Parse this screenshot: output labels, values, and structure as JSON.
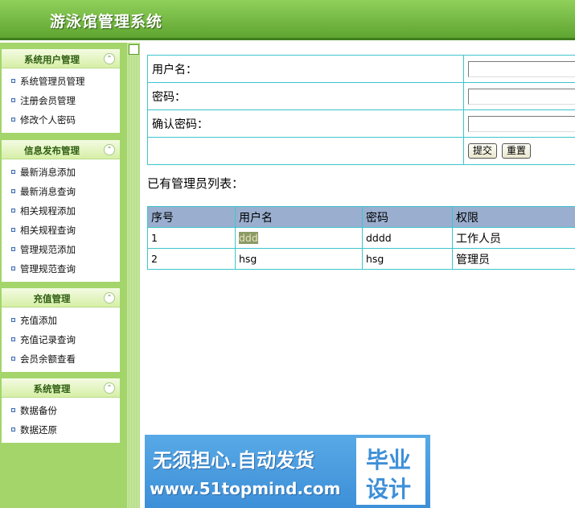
{
  "app": {
    "title": "游泳馆管理系统"
  },
  "sidebar": {
    "groups": [
      {
        "title": "系统用户管理",
        "toggle": "⌃",
        "items": [
          "系统管理员管理",
          "注册会员管理",
          "修改个人密码"
        ]
      },
      {
        "title": "信息发布管理",
        "toggle": "⌃",
        "items": [
          "最新消息添加",
          "最新消息查询",
          "相关规程添加",
          "相关规程查询",
          "管理规范添加",
          "管理规范查询"
        ]
      },
      {
        "title": "充值管理",
        "toggle": "⌃",
        "items": [
          "充值添加",
          "充值记录查询",
          "会员余额查看"
        ]
      },
      {
        "title": "系统管理",
        "toggle": "⌃",
        "items": [
          "数据备份",
          "数据还原"
        ]
      }
    ]
  },
  "form": {
    "username_label": "用户名：",
    "username_value": "",
    "password_label": "密码：",
    "password_value": "",
    "confirm_label": "确认密码：",
    "confirm_value": "",
    "submit_label": "提交",
    "reset_label": "重置"
  },
  "list": {
    "title": "已有管理员列表：",
    "columns": [
      "序号",
      "用户名",
      "密码",
      "权限"
    ],
    "rows": [
      [
        "1",
        "ddd",
        "dddd",
        "工作人员"
      ],
      [
        "2",
        "hsg",
        "hsg",
        "管理员"
      ]
    ]
  },
  "banner": {
    "line1": "无须担心.自动发货",
    "line2": "www.51topmind.com",
    "badge1": "毕业",
    "badge2": "设计"
  }
}
